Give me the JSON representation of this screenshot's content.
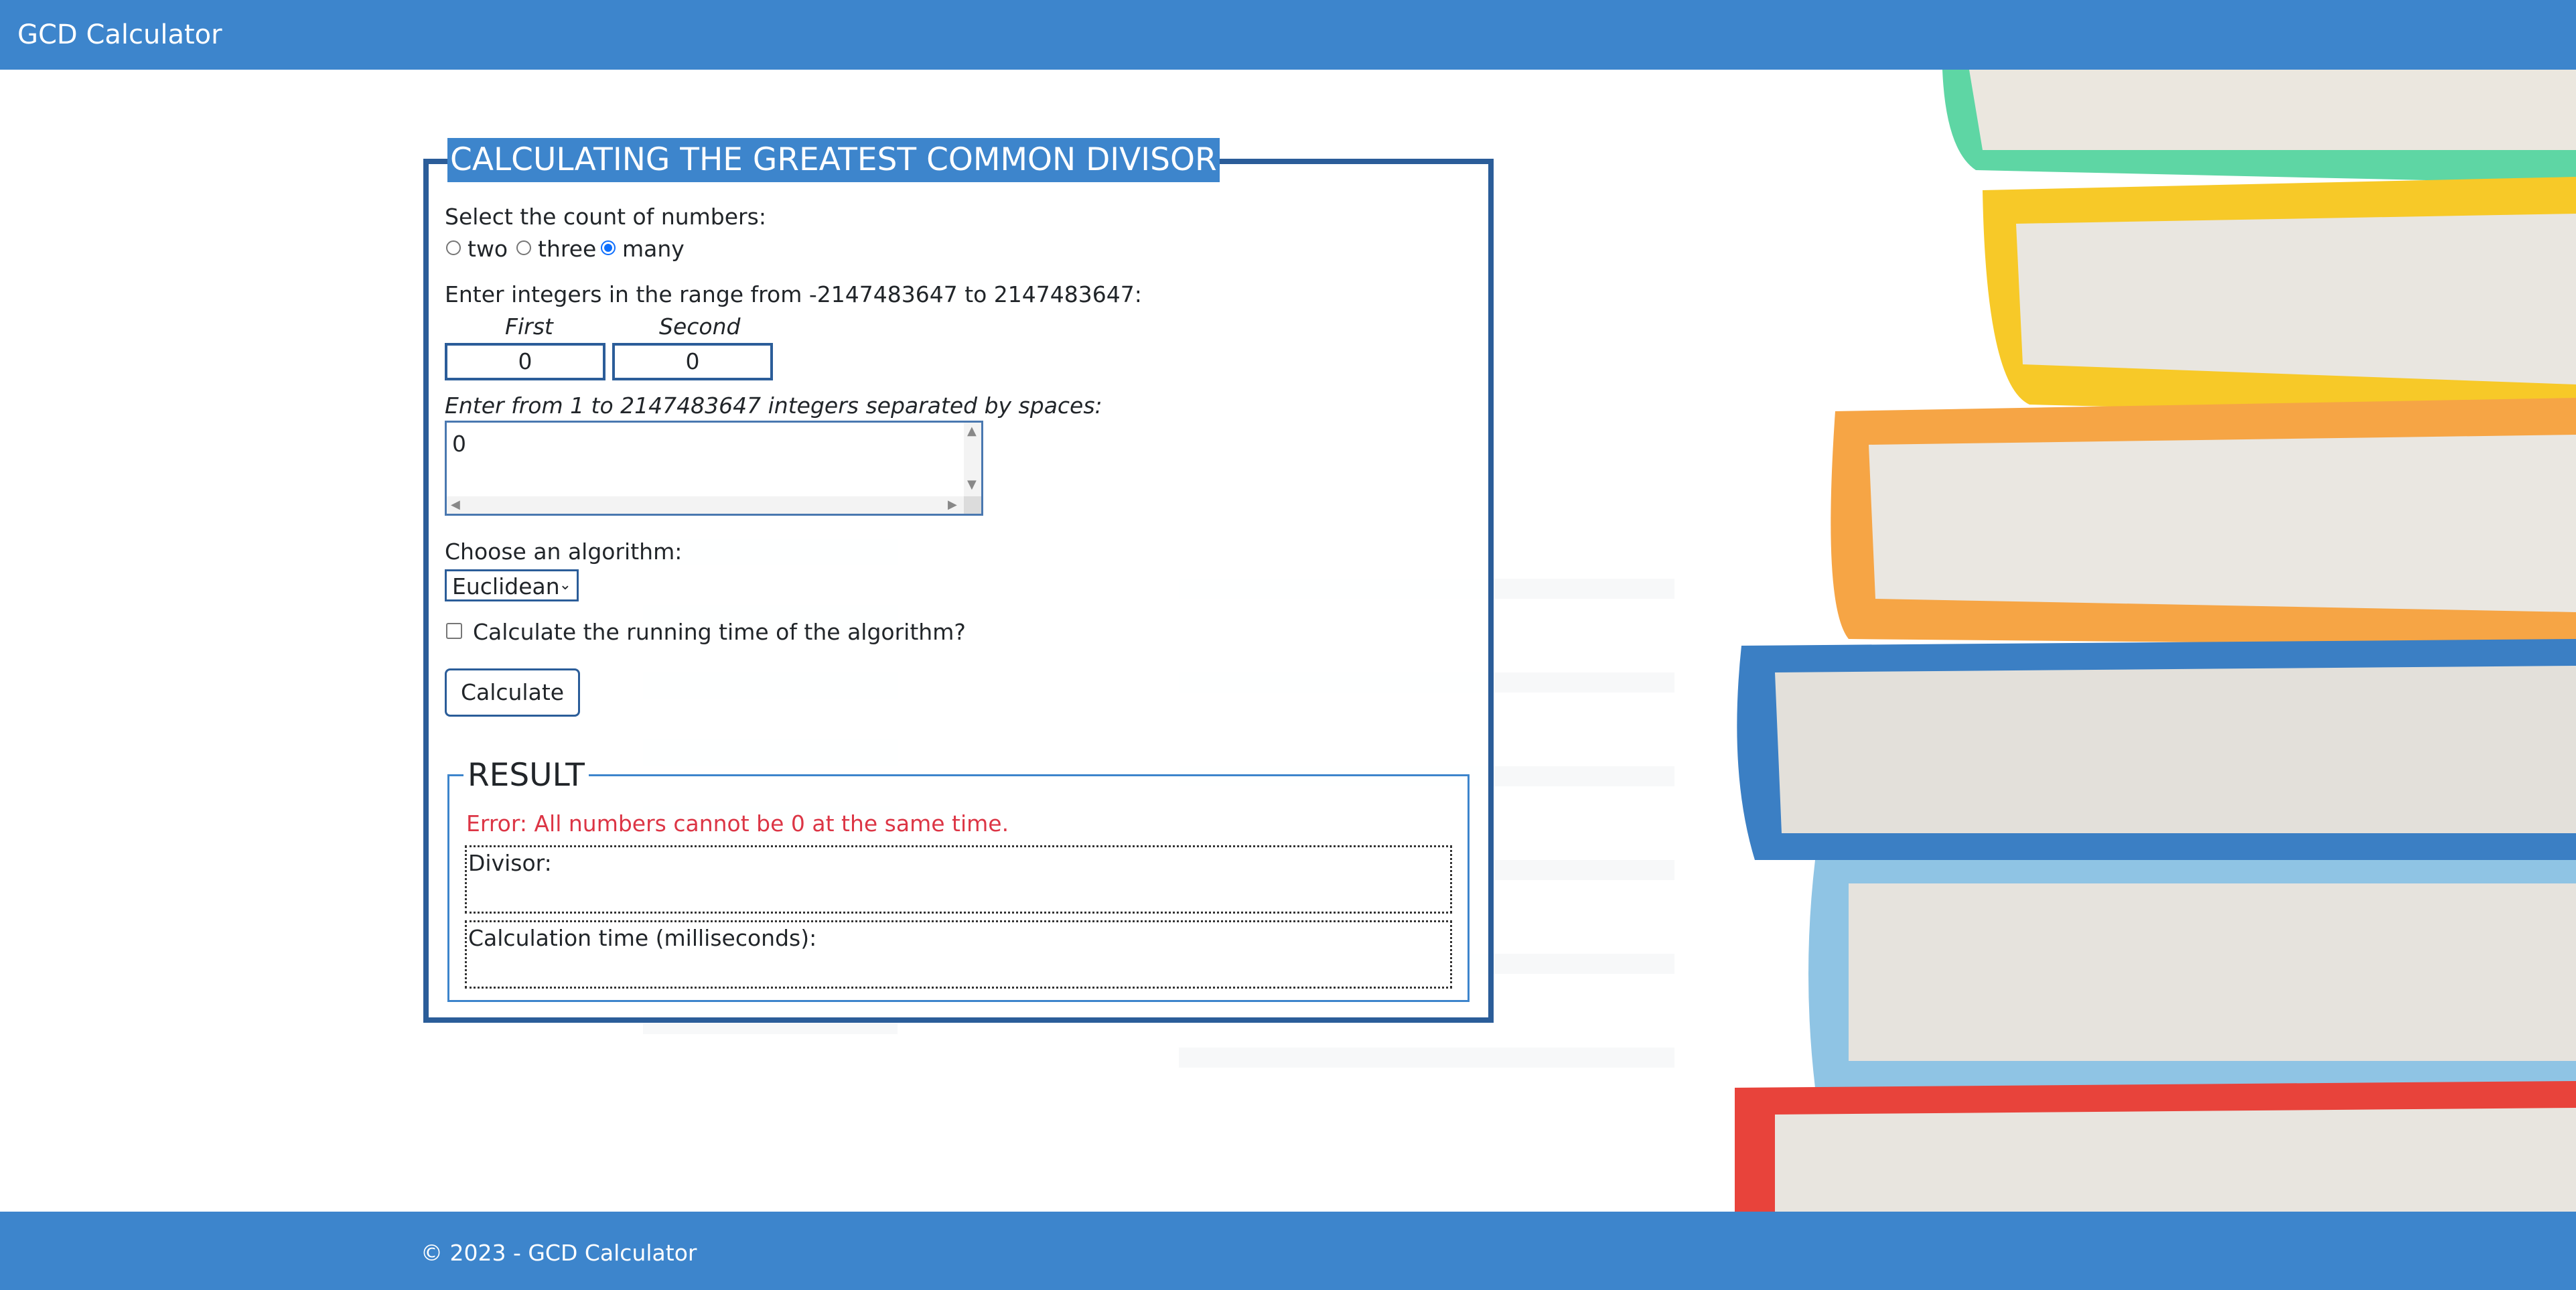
{
  "app": {
    "title": "GCD Calculator"
  },
  "form": {
    "legend": "CALCULATING THE GREATEST COMMON DIVISOR",
    "count_label": "Select the count of numbers:",
    "count_options": [
      {
        "label": "two",
        "selected": false
      },
      {
        "label": "three",
        "selected": false
      },
      {
        "label": "many",
        "selected": true
      }
    ],
    "range_label": "Enter integers in the range from -2147483647 to 2147483647:",
    "first_label": "First",
    "second_label": "Second",
    "first_value": "0",
    "second_value": "0",
    "many_label": "Enter from 1 to 2147483647 integers separated by spaces:",
    "many_value": "0",
    "algorithm_label": "Choose an algorithm:",
    "algorithm_value": "Euclidean",
    "timing_label": "Calculate the running time of the algorithm?",
    "timing_checked": false,
    "calculate_label": "Calculate"
  },
  "result": {
    "legend": "RESULT",
    "error": "Error: All numbers cannot be 0 at the same time.",
    "divisor_label": "Divisor:",
    "time_label": "Calculation time (milliseconds):"
  },
  "footer": {
    "text": "© 2023 - GCD Calculator"
  },
  "colors": {
    "header": "#3d85cc",
    "border": "#2b5d99",
    "error": "#dc3545"
  }
}
